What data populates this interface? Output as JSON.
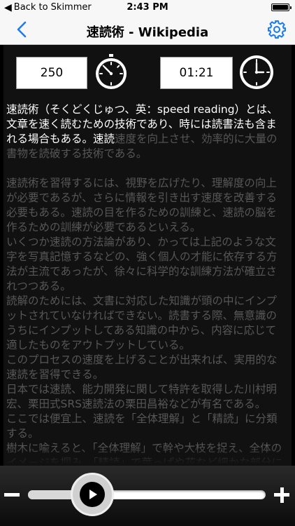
{
  "status_bar": {
    "back_label": "Back to Skimmer",
    "time": "2:43 PM"
  },
  "nav": {
    "title": "速読術 - Wikipedia",
    "accent_color": "#1a7bf2"
  },
  "stats": {
    "words_per_minute": "250",
    "elapsed_time": "01:21"
  },
  "reader": {
    "read_text": "速読術（そくどくじゅつ、英：speed reading）とは、文章を速く読むための技術であり、時には読書法も含まれる場合もある。速読",
    "unread_text": "速度を向上させ、効率的に大量の書物を読破する技術である。",
    "paragraphs": [
      "速読術を習得するには、視野を広げたり、理解度の向上が必要であるが、さらに情報を引き出す速度を改善する必要もある。速読の目を作るための訓練と、速読の脳を作るための訓練が必要であるといえる。",
      "いくつか速読の方法論があり、かっては上記のような文字を写真記憶するなどの、強く個人の才能に依存する方法が主流であったが、徐々に科学的な訓練方法が確立されつつある。",
      "読解のためには、文書に対応した知識が頭の中にインプットされていなければできない。読書する際、無意識のうちにインプットしてある知識の中から、内容に応じて適したものをアウトプットしている。",
      "このプロセスの速度を上げることが出来れば、実用的な速読を習得できる。",
      "日本では速読、能力開発に関して特許を取得した川村明宏、栗田式SRS速読法の栗田昌裕などが有名である。",
      "ここでは便宜上、速読を「全体理解」と「精読」に分類する。",
      "樹木に喩えると、「全体理解」で幹や大枝を捉え、全体のイメージを掴み、「精読」で葉っぱや花など細かな部分にまで注意を向ける。専門書や試験問題を読んで理解するとき、"
    ]
  },
  "playback": {
    "progress": 0.27,
    "state": "paused"
  },
  "icons": {
    "back": "chevron-left-icon",
    "settings": "gear-icon",
    "speed": "stopwatch-icon",
    "elapsed": "clock-icon",
    "play": "play-icon",
    "decrease": "minus-icon",
    "increase": "plus-icon"
  }
}
